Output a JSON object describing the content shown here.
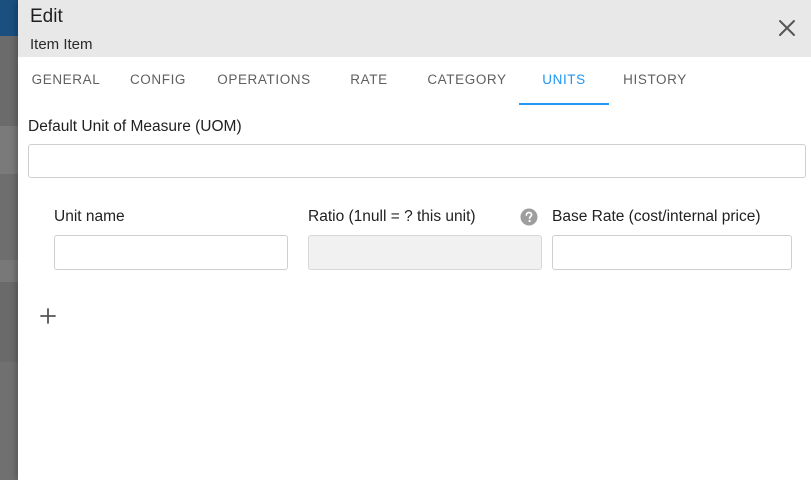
{
  "dialog": {
    "title": "Edit",
    "subtitle": "Item Item"
  },
  "tabs": [
    {
      "label": "GENERAL",
      "active": false
    },
    {
      "label": "CONFIG",
      "active": false
    },
    {
      "label": "OPERATIONS",
      "active": false
    },
    {
      "label": "RATE",
      "active": false
    },
    {
      "label": "CATEGORY",
      "active": false
    },
    {
      "label": "UNITS",
      "active": true
    },
    {
      "label": "HISTORY",
      "active": false
    }
  ],
  "units": {
    "default_uom_label": "Default Unit of Measure (UOM)",
    "default_uom_value": "",
    "unit_name_label": "Unit name",
    "ratio_label": "Ratio (1null = ? this unit)",
    "base_rate_label": "Base Rate (cost/internal price)",
    "unit_name_value": "",
    "ratio_value": "",
    "base_rate_value": ""
  },
  "icons": {
    "close": "close-icon",
    "help": "help-circle-icon",
    "add": "plus-icon"
  },
  "colors": {
    "accent": "#2196f3",
    "header_bg": "#e8e8e8",
    "tab_inactive": "#5f5f5f"
  }
}
